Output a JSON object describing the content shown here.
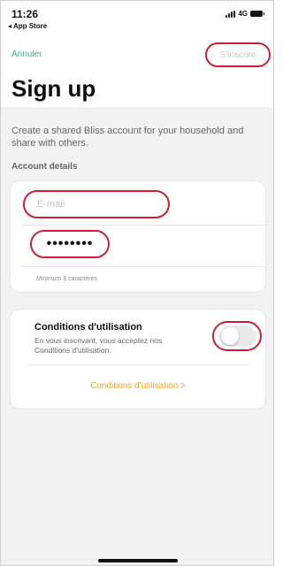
{
  "status_bar": {
    "time": "11:26",
    "back_app": "◂ App Store",
    "network": "4G"
  },
  "nav": {
    "cancel_label": "Annuler",
    "signup_label": "S'inscrire"
  },
  "page_title": "Sign up",
  "intro_text": "Create a shared Bliss account for your household and share with others.",
  "account_section": {
    "label": "Account details",
    "email_placeholder": "E-mail",
    "password_value": "••••••••",
    "password_hint": "Minimum 8 caractères"
  },
  "terms": {
    "title": "Conditions d'utilisation",
    "description": "En vous inscrivant, vous acceptez nos Conditions d'utilisation.",
    "toggle_on": false,
    "link_label": "Conditions d'utilisation >"
  },
  "colors": {
    "accent_green": "#2fb58c",
    "accent_orange": "#e9a32c",
    "highlight_red": "#c8202f"
  }
}
